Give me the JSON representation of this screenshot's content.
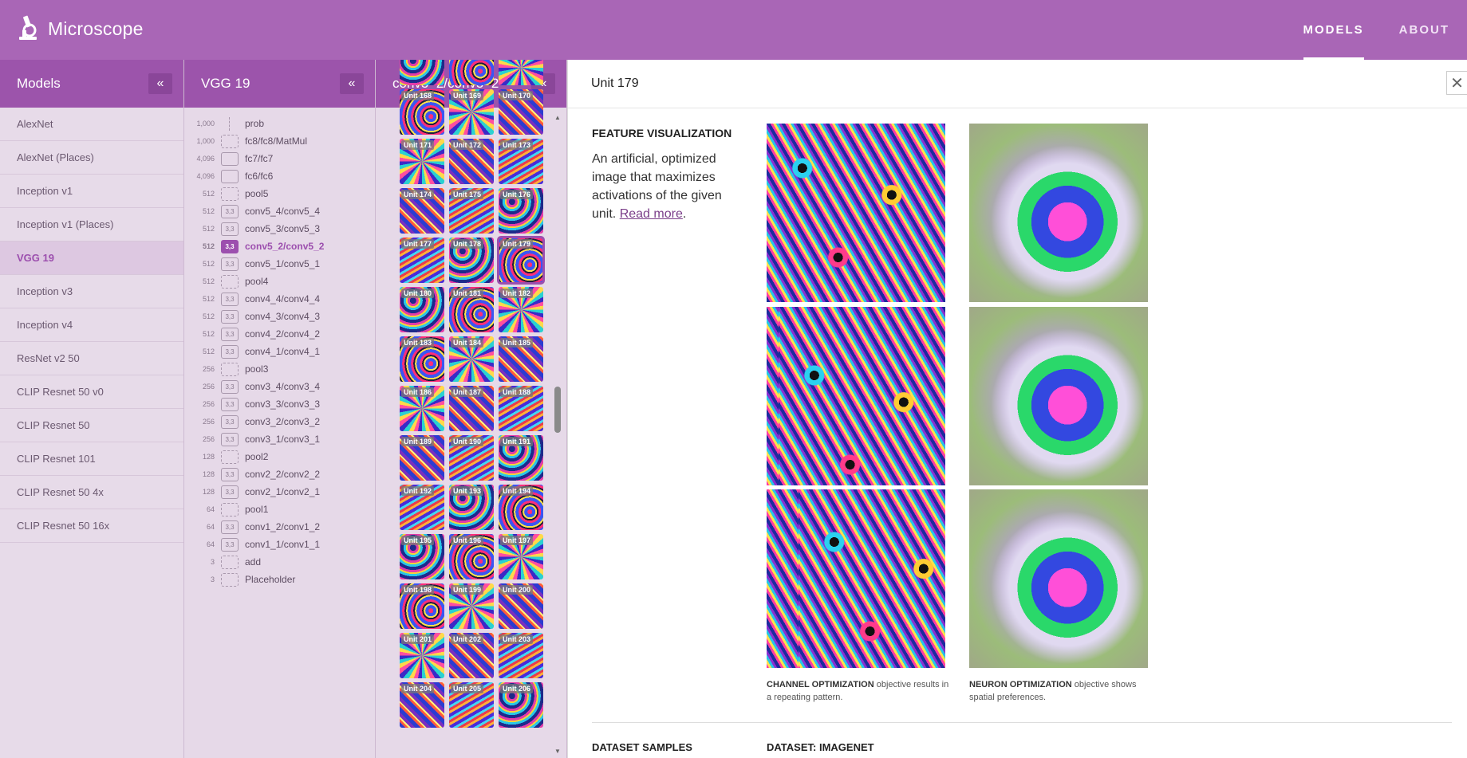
{
  "app": {
    "name": "Microscope"
  },
  "topnav": {
    "models": "MODELS",
    "about": "ABOUT"
  },
  "models_panel": {
    "title": "Models",
    "items": [
      "AlexNet",
      "AlexNet (Places)",
      "Inception v1",
      "Inception v1 (Places)",
      "VGG 19",
      "Inception v3",
      "Inception v4",
      "ResNet v2 50",
      "CLIP Resnet 50 v0",
      "CLIP Resnet 50",
      "CLIP Resnet 101",
      "CLIP Resnet 50 4x",
      "CLIP Resnet 50 16x"
    ],
    "selected": "VGG 19"
  },
  "layers_panel": {
    "title": "VGG 19",
    "layers": [
      {
        "count": "1,000",
        "box": "",
        "kind": "line",
        "name": "prob"
      },
      {
        "count": "1,000",
        "box": "",
        "kind": "dashed",
        "name": "fc8/fc8/MatMul"
      },
      {
        "count": "4,096",
        "box": "",
        "kind": "solid",
        "name": "fc7/fc7"
      },
      {
        "count": "4,096",
        "box": "",
        "kind": "solid",
        "name": "fc6/fc6"
      },
      {
        "count": "512",
        "box": "",
        "kind": "dashed",
        "name": "pool5"
      },
      {
        "count": "512",
        "box": "3,3",
        "kind": "solid",
        "name": "conv5_4/conv5_4"
      },
      {
        "count": "512",
        "box": "3,3",
        "kind": "solid",
        "name": "conv5_3/conv5_3"
      },
      {
        "count": "512",
        "box": "3,3",
        "kind": "solid",
        "name": "conv5_2/conv5_2",
        "active": true
      },
      {
        "count": "512",
        "box": "3,3",
        "kind": "solid",
        "name": "conv5_1/conv5_1"
      },
      {
        "count": "512",
        "box": "",
        "kind": "dashed",
        "name": "pool4"
      },
      {
        "count": "512",
        "box": "3,3",
        "kind": "solid",
        "name": "conv4_4/conv4_4"
      },
      {
        "count": "512",
        "box": "3,3",
        "kind": "solid",
        "name": "conv4_3/conv4_3"
      },
      {
        "count": "512",
        "box": "3,3",
        "kind": "solid",
        "name": "conv4_2/conv4_2"
      },
      {
        "count": "512",
        "box": "3,3",
        "kind": "solid",
        "name": "conv4_1/conv4_1"
      },
      {
        "count": "256",
        "box": "",
        "kind": "dashed",
        "name": "pool3"
      },
      {
        "count": "256",
        "box": "3,3",
        "kind": "solid",
        "name": "conv3_4/conv3_4"
      },
      {
        "count": "256",
        "box": "3,3",
        "kind": "solid",
        "name": "conv3_3/conv3_3"
      },
      {
        "count": "256",
        "box": "3,3",
        "kind": "solid",
        "name": "conv3_2/conv3_2"
      },
      {
        "count": "256",
        "box": "3,3",
        "kind": "solid",
        "name": "conv3_1/conv3_1"
      },
      {
        "count": "128",
        "box": "",
        "kind": "dashed",
        "name": "pool2"
      },
      {
        "count": "128",
        "box": "3,3",
        "kind": "solid",
        "name": "conv2_2/conv2_2"
      },
      {
        "count": "128",
        "box": "3,3",
        "kind": "solid",
        "name": "conv2_1/conv2_1"
      },
      {
        "count": "64",
        "box": "",
        "kind": "dashed",
        "name": "pool1"
      },
      {
        "count": "64",
        "box": "3,3",
        "kind": "solid",
        "name": "conv1_2/conv1_2"
      },
      {
        "count": "64",
        "box": "3,3",
        "kind": "solid",
        "name": "conv1_1/conv1_1"
      },
      {
        "count": "3",
        "box": "",
        "kind": "dashed",
        "name": "add"
      },
      {
        "count": "3",
        "box": "",
        "kind": "dashed",
        "name": "Placeholder"
      }
    ]
  },
  "units_panel": {
    "title": "conv5_2/conv5_2",
    "units": [
      "",
      "",
      "",
      "Unit 168",
      "Unit 169",
      "Unit 170",
      "Unit 171",
      "Unit 172",
      "Unit 173",
      "Unit 174",
      "Unit 175",
      "Unit 176",
      "Unit 177",
      "Unit 178",
      "Unit 179",
      "Unit 180",
      "Unit 181",
      "Unit 182",
      "Unit 183",
      "Unit 184",
      "Unit 185",
      "Unit 186",
      "Unit 187",
      "Unit 188",
      "Unit 189",
      "Unit 190",
      "Unit 191",
      "Unit 192",
      "Unit 193",
      "Unit 194",
      "Unit 195",
      "Unit 196",
      "Unit 197",
      "Unit 198",
      "Unit 199",
      "Unit 200",
      "Unit 201",
      "Unit 202",
      "Unit 203",
      "Unit 204",
      "Unit 205",
      "Unit 206"
    ],
    "selected": "Unit 179"
  },
  "detail": {
    "title": "Unit 179",
    "close_icon": "close-icon",
    "feature_viz": {
      "heading": "FEATURE VISUALIZATION",
      "desc": "An artificial, optimized image that maximizes activations of the given unit.",
      "read_more": "Read more",
      "period": "."
    },
    "channel_caption": {
      "bold": "CHANNEL OPTIMIZATION",
      "rest": " objective results in a repeating pattern."
    },
    "neuron_caption": {
      "bold": "NEURON OPTIMIZATION",
      "rest": " objective shows spatial preferences."
    },
    "dataset_heading": "DATASET SAMPLES",
    "dataset_name": "DATASET: IMAGENET"
  },
  "colors": {
    "topbar": "#a966b6",
    "panel_head": "#9c54ab",
    "accent": "#9c4fae"
  }
}
